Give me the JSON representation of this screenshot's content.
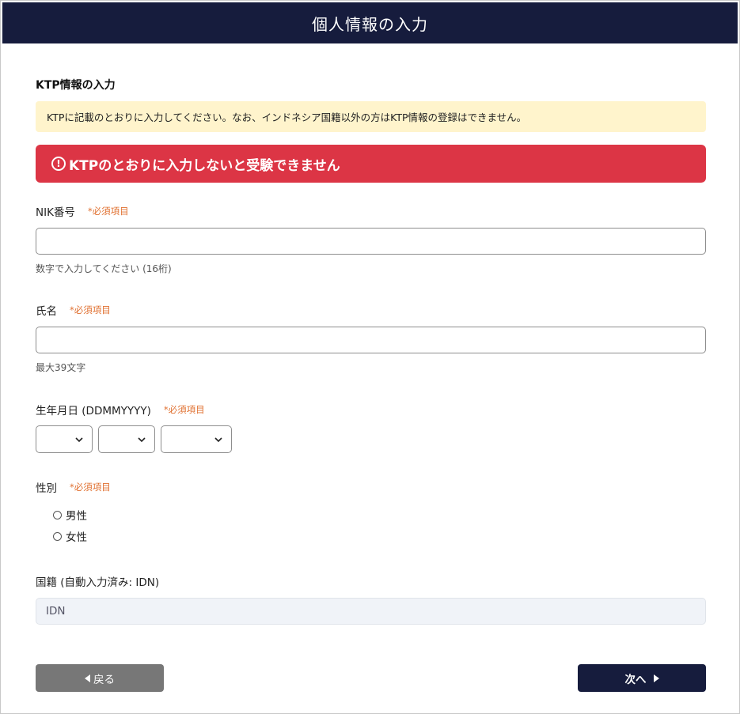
{
  "header": {
    "title": "個人情報の入力"
  },
  "section": {
    "title": "KTP情報の入力",
    "notice": "KTPに記載のとおりに入力してください。なお、インドネシア国籍以外の方はKTP情報の登録はできません。",
    "alert": "KTPのとおりに入力しないと受験できません",
    "alert_icon_glyph": "!"
  },
  "required_mark": "*必須項目",
  "nik": {
    "label": "NIK番号",
    "value": "",
    "hint": "数字で入力してください (16桁)"
  },
  "name": {
    "label": "氏名",
    "value": "",
    "hint": "最大39文字"
  },
  "dob": {
    "label": "生年月日 (DDMMYYYY)",
    "day": "",
    "month": "",
    "year": ""
  },
  "gender": {
    "label": "性別",
    "options": [
      "男性",
      "女性"
    ]
  },
  "nationality": {
    "label": "国籍 (自動入力済み: IDN)",
    "value": "IDN"
  },
  "buttons": {
    "back": "戻る",
    "next": "次へ"
  },
  "colors": {
    "header": "#161c3d",
    "alert": "#dc3545",
    "notice": "#fff4cc",
    "required": "#e07030",
    "back": "#777777"
  }
}
